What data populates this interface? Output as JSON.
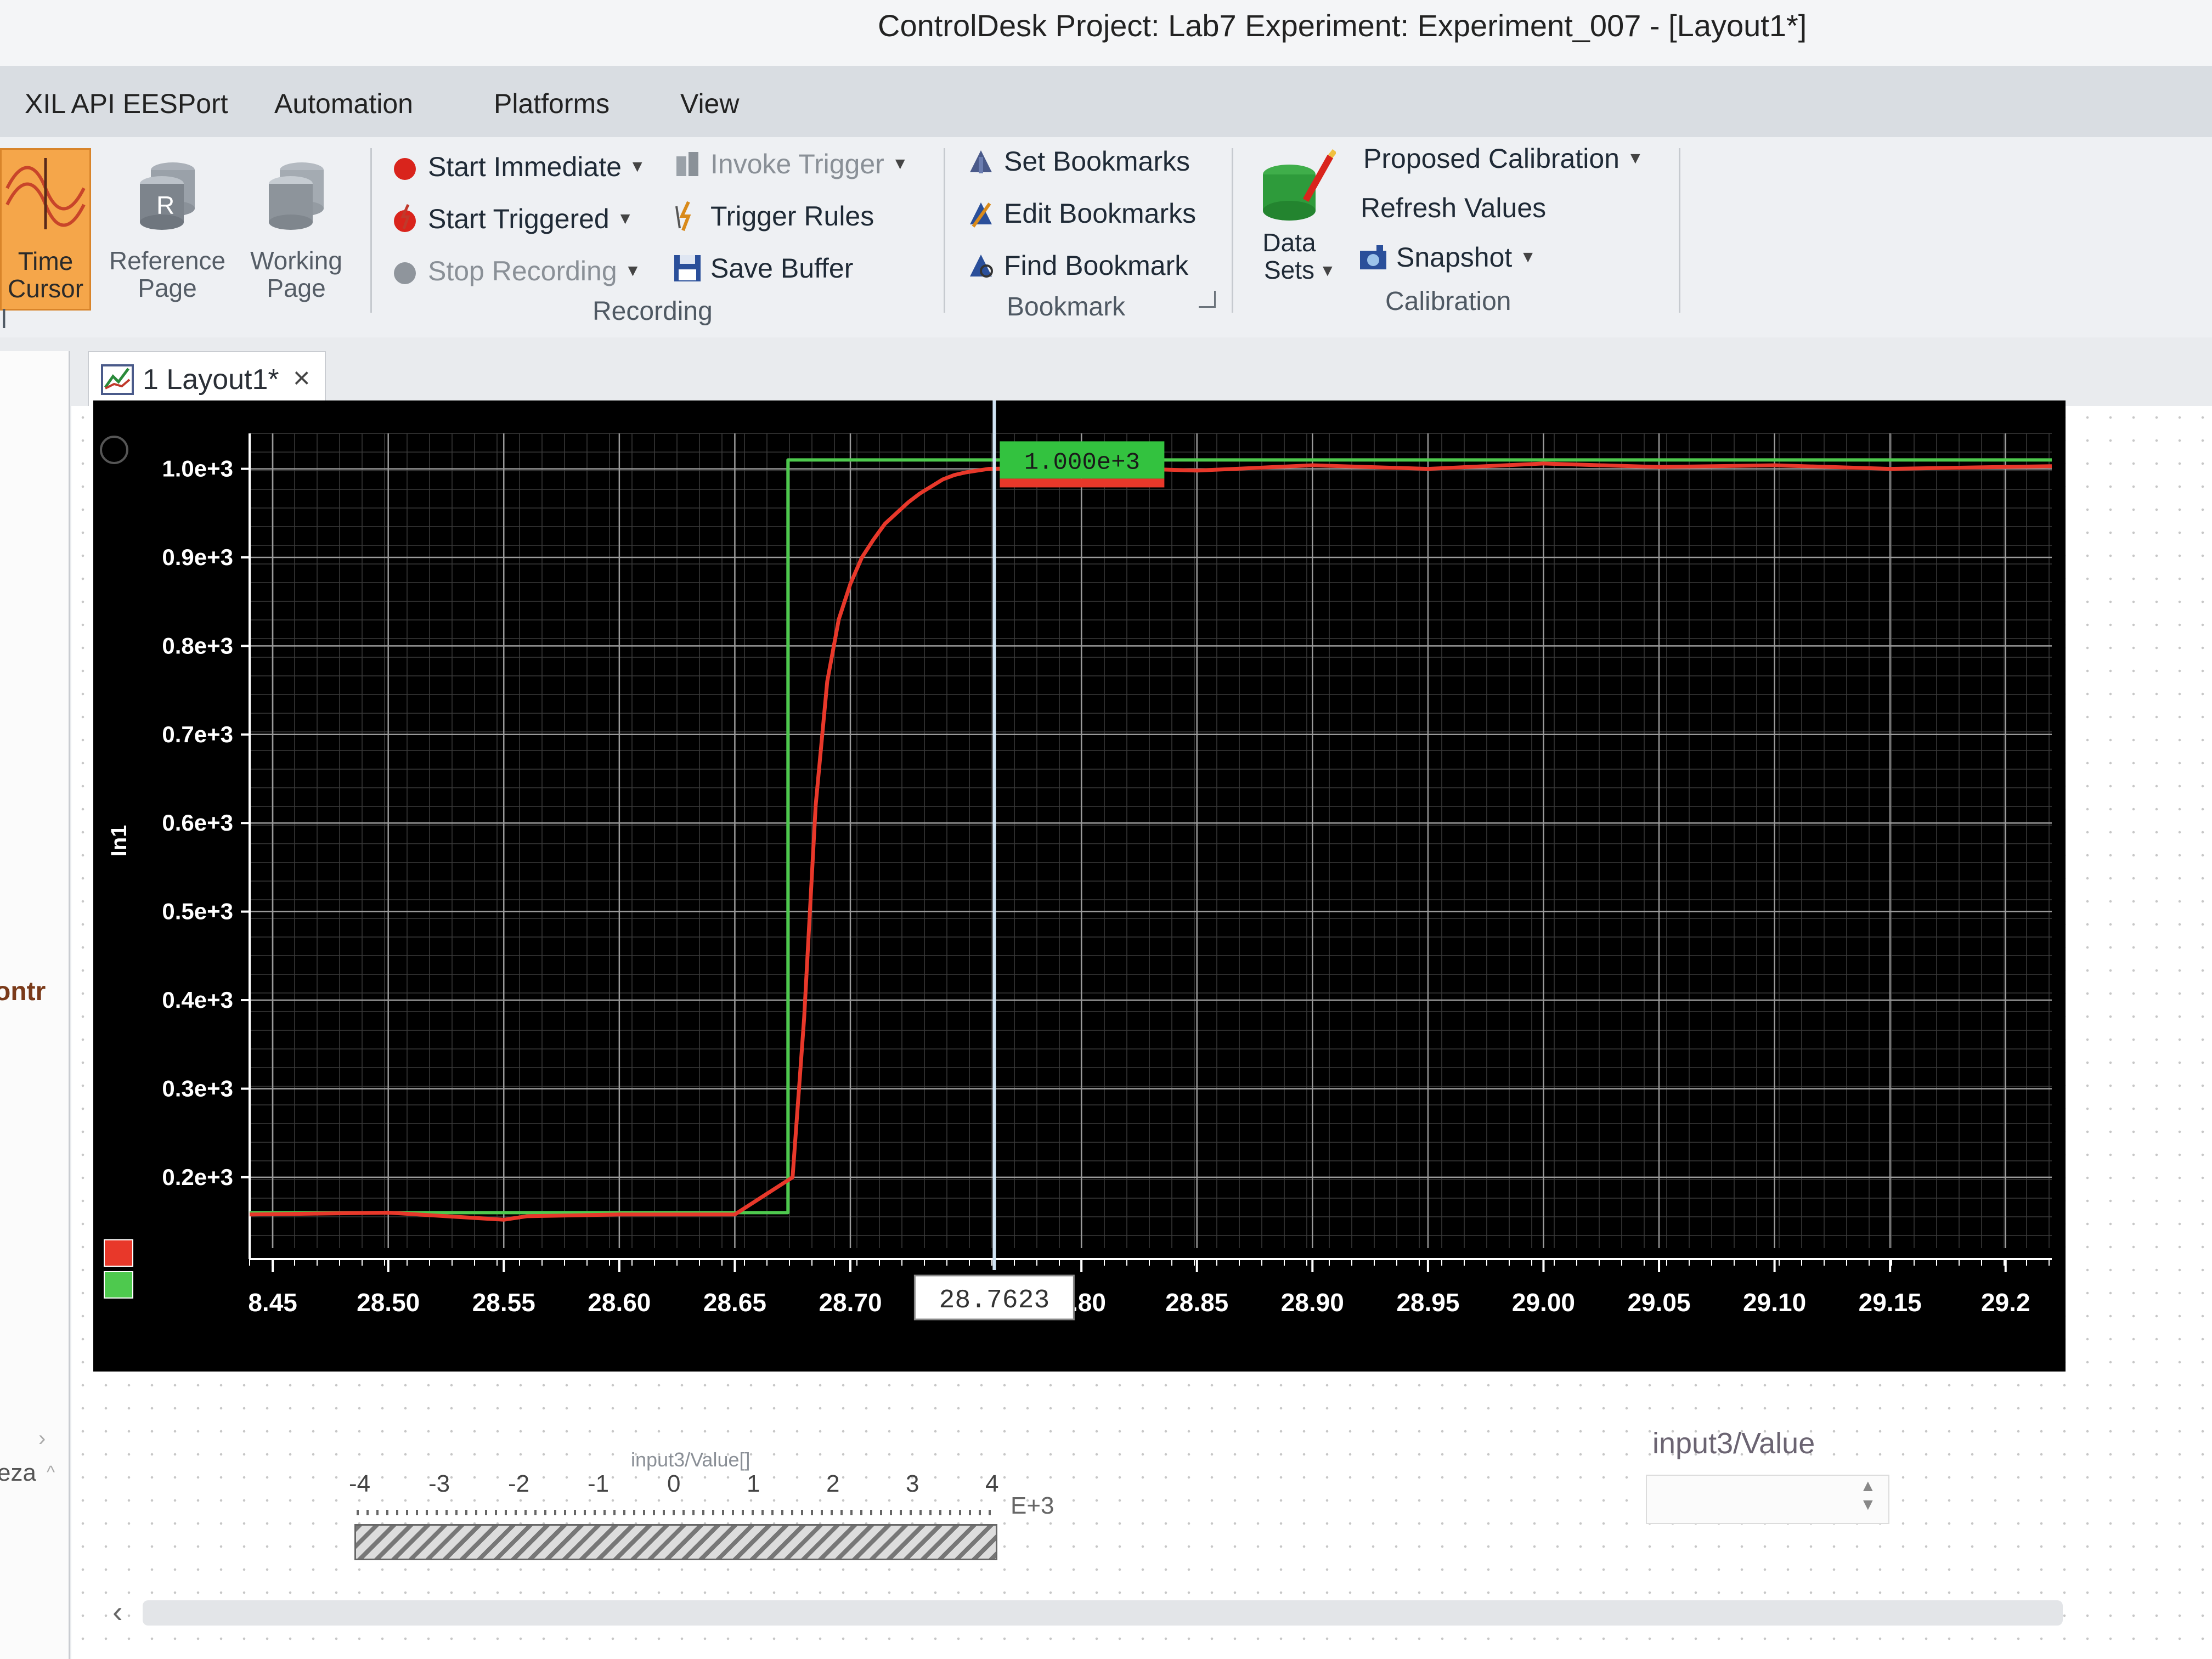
{
  "window": {
    "title": "ControlDesk  Project: Lab7  Experiment: Experiment_007 - [Layout1*]"
  },
  "menu": [
    "XIL API EESPort",
    "Automation",
    "Platforms",
    "View"
  ],
  "ribbon": {
    "time_cursor": "Time Cursor",
    "reference_page": "Reference Page",
    "working_page": "Working Page",
    "partial_label": "l",
    "recording": {
      "start_immediate": "Start Immediate",
      "start_triggered": "Start Triggered",
      "stop_recording": "Stop Recording",
      "invoke_trigger": "Invoke Trigger",
      "trigger_rules": "Trigger Rules",
      "save_buffer": "Save Buffer",
      "group": "Recording"
    },
    "bookmark": {
      "set": "Set Bookmarks",
      "edit": "Edit Bookmarks",
      "find": "Find Bookmark",
      "group": "Bookmark"
    },
    "calibration": {
      "data_sets": "Data Sets",
      "proposed": "Proposed Calibration",
      "refresh": "Refresh Values",
      "snapshot": "Snapshot",
      "group": "Calibration"
    }
  },
  "tabs": {
    "doc_tab": "1 Layout1*",
    "close_glyph": "×",
    "left_close": "×"
  },
  "left_panel": {
    "partial_text": "ontr",
    "partial_text2": "eza"
  },
  "chart_data": {
    "type": "line",
    "ylabel": "In1",
    "xlim": [
      28.44,
      29.22
    ],
    "ylim": [
      120,
      1040
    ],
    "yticks": [
      "1.0e+3",
      "0.9e+3",
      "0.8e+3",
      "0.7e+3",
      "0.6e+3",
      "0.5e+3",
      "0.4e+3",
      "0.3e+3",
      "0.2e+3"
    ],
    "ytick_values": [
      1000,
      900,
      800,
      700,
      600,
      500,
      400,
      300,
      200
    ],
    "xticks": [
      "8.45",
      "28.50",
      "28.55",
      "28.60",
      "28.65",
      "28.70",
      "3.80",
      "28.85",
      "28.90",
      "28.95",
      "29.00",
      "29.05",
      "29.10",
      "29.15",
      "29.2"
    ],
    "xtick_values": [
      28.45,
      28.5,
      28.55,
      28.6,
      28.65,
      28.7,
      28.8,
      28.85,
      28.9,
      28.95,
      29.0,
      29.05,
      29.1,
      29.15,
      29.2
    ],
    "cursor": {
      "x": 28.7623,
      "label": "28.7623",
      "value_label": "1.000e+3"
    },
    "series": [
      {
        "color": "#4ec94e",
        "x": [
          28.44,
          28.673,
          28.673,
          29.22
        ],
        "y": [
          160,
          160,
          1010,
          1010
        ]
      },
      {
        "color": "#e8382a",
        "x": [
          28.44,
          28.5,
          28.55,
          28.56,
          28.6,
          28.65,
          28.675,
          28.68,
          28.685,
          28.69,
          28.695,
          28.7,
          28.705,
          28.71,
          28.715,
          28.72,
          28.725,
          28.73,
          28.735,
          28.74,
          28.745,
          28.75,
          28.76,
          28.8,
          28.85,
          28.9,
          28.95,
          29.0,
          29.05,
          29.1,
          29.15,
          29.22
        ],
        "y": [
          158,
          160,
          152,
          156,
          158,
          158,
          200,
          380,
          620,
          760,
          830,
          870,
          900,
          920,
          938,
          950,
          962,
          972,
          980,
          988,
          993,
          996,
          1000,
          1002,
          998,
          1004,
          1000,
          1006,
          1002,
          1004,
          1000,
          1003
        ]
      }
    ]
  },
  "scale_widget": {
    "title": "input3/Value[]",
    "ticks": [
      "-4",
      "-3",
      "-2",
      "-1",
      "0",
      "1",
      "2",
      "3",
      "4"
    ],
    "exponent": "E+3"
  },
  "value_widget": {
    "label": "input3/Value",
    "value": ""
  }
}
